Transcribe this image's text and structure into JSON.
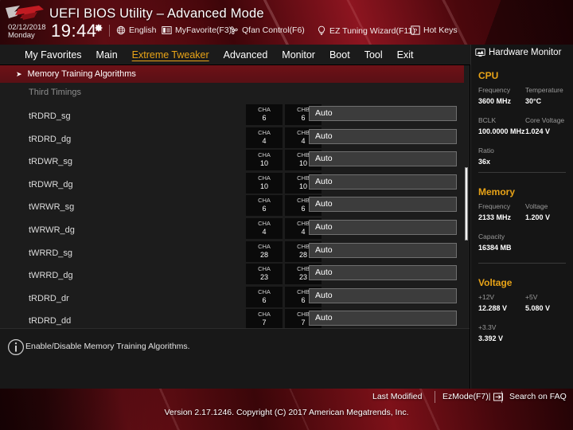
{
  "header": {
    "title": "UEFI BIOS Utility – Advanced Mode",
    "date": "02/12/2018",
    "weekday": "Monday",
    "time": "19:44",
    "gear_icon": "gear-icon",
    "logo_icon": "rog-logo",
    "items": [
      {
        "label": "English",
        "icon": "globe-icon"
      },
      {
        "label": "MyFavorite(F3)",
        "icon": "bookmark-list-icon"
      },
      {
        "label": "Qfan Control(F6)",
        "icon": "fan-icon"
      },
      {
        "label": "EZ Tuning Wizard(F11)",
        "icon": "lightbulb-icon"
      },
      {
        "label": "Hot Keys",
        "icon": "question-box-icon"
      }
    ]
  },
  "tabs": [
    {
      "label": "My Favorites",
      "active": false
    },
    {
      "label": "Main",
      "active": false
    },
    {
      "label": "Extreme Tweaker",
      "active": true
    },
    {
      "label": "Advanced",
      "active": false
    },
    {
      "label": "Monitor",
      "active": false
    },
    {
      "label": "Boot",
      "active": false
    },
    {
      "label": "Tool",
      "active": false
    },
    {
      "label": "Exit",
      "active": false
    }
  ],
  "main": {
    "selected_item": "Memory Training Algorithms",
    "selected_arrow": "➤",
    "section_header": "Third Timings",
    "col_a_label": "CHA",
    "col_b_label": "CHB",
    "rows": [
      {
        "name": "tRDRD_sg",
        "cha": "6",
        "chb": "6",
        "value": "Auto"
      },
      {
        "name": "tRDRD_dg",
        "cha": "4",
        "chb": "4",
        "value": "Auto"
      },
      {
        "name": "tRDWR_sg",
        "cha": "10",
        "chb": "10",
        "value": "Auto"
      },
      {
        "name": "tRDWR_dg",
        "cha": "10",
        "chb": "10",
        "value": "Auto"
      },
      {
        "name": "tWRWR_sg",
        "cha": "6",
        "chb": "6",
        "value": "Auto"
      },
      {
        "name": "tWRWR_dg",
        "cha": "4",
        "chb": "4",
        "value": "Auto"
      },
      {
        "name": "tWRRD_sg",
        "cha": "28",
        "chb": "28",
        "value": "Auto"
      },
      {
        "name": "tWRRD_dg",
        "cha": "23",
        "chb": "23",
        "value": "Auto"
      },
      {
        "name": "tRDRD_dr",
        "cha": "6",
        "chb": "6",
        "value": "Auto"
      },
      {
        "name": "tRDRD_dd",
        "cha": "7",
        "chb": "7",
        "value": "Auto"
      }
    ]
  },
  "help": {
    "icon": "info-icon",
    "text": "Enable/Disable Memory Training Algorithms."
  },
  "sidebar": {
    "title": "Hardware Monitor",
    "title_icon": "monitor-icon",
    "sections": [
      {
        "name": "CPU",
        "fields": [
          {
            "label": "Frequency",
            "value": "3600 MHz"
          },
          {
            "label": "Temperature",
            "value": "30°C"
          },
          {
            "label": "BCLK",
            "value": "100.0000 MHz"
          },
          {
            "label": "Core Voltage",
            "value": "1.024 V"
          },
          {
            "label": "Ratio",
            "value": "36x"
          }
        ]
      },
      {
        "name": "Memory",
        "fields": [
          {
            "label": "Frequency",
            "value": "2133 MHz"
          },
          {
            "label": "Voltage",
            "value": "1.200 V"
          },
          {
            "label": "Capacity",
            "value": "16384 MB"
          }
        ]
      },
      {
        "name": "Voltage",
        "fields": [
          {
            "label": "+12V",
            "value": "12.288 V"
          },
          {
            "label": "+5V",
            "value": "5.080 V"
          },
          {
            "label": "+3.3V",
            "value": "3.392 V"
          }
        ]
      }
    ]
  },
  "footer": {
    "links": [
      {
        "label": "Last Modified",
        "icon": ""
      },
      {
        "label": "EzMode(F7)|",
        "icon": "arrow-right-box-icon"
      },
      {
        "label": "Search on FAQ",
        "icon": ""
      }
    ],
    "version": "Version 2.17.1246. Copyright (C) 2017 American Megatrends, Inc."
  },
  "colors": {
    "accent_orange": "#e8a317",
    "selection_red": "#6e1117",
    "panel_bg": "#1c1c1c",
    "sidebar_bg": "#151515"
  }
}
